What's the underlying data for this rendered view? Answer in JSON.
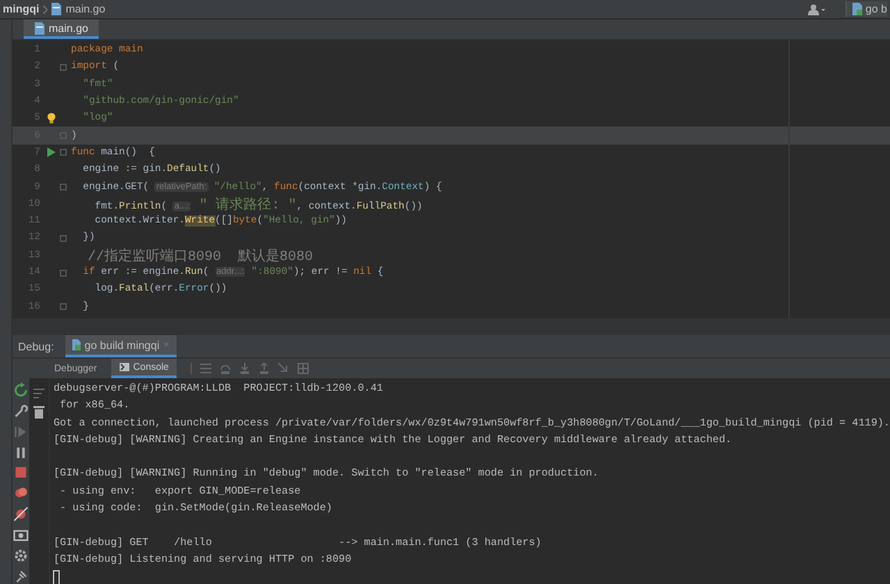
{
  "navbar": {
    "project": "mingqi",
    "file": "main.go",
    "run_config": "go b"
  },
  "editor": {
    "tabs": [
      {
        "label": "main.go",
        "selected": true
      }
    ],
    "lines": [
      {
        "number": "1",
        "current": false,
        "fold": false,
        "run": false,
        "bulb": false,
        "tokens": [
          {
            "text": "package main",
            "kind": "keyword"
          }
        ]
      },
      {
        "number": "2",
        "current": false,
        "fold": true,
        "run": false,
        "bulb": false,
        "tokens": [
          {
            "text": "import",
            "kind": "keyword"
          },
          {
            "text": " (",
            "kind": "plain"
          }
        ]
      },
      {
        "number": "3",
        "current": false,
        "fold": false,
        "run": false,
        "bulb": false,
        "tokens": [
          {
            "text": "  \"fmt\"",
            "kind": "string"
          }
        ]
      },
      {
        "number": "4",
        "current": false,
        "fold": false,
        "run": false,
        "bulb": false,
        "tokens": [
          {
            "text": "  \"github.com/gin-gonic/gin\"",
            "kind": "string"
          }
        ]
      },
      {
        "number": "5",
        "current": false,
        "fold": false,
        "run": false,
        "bulb": true,
        "tokens": [
          {
            "text": "  \"log\"",
            "kind": "string"
          }
        ]
      },
      {
        "number": "6",
        "current": true,
        "fold": true,
        "run": false,
        "bulb": false,
        "tokens": [
          {
            "text": ")",
            "kind": "plain"
          }
        ]
      },
      {
        "number": "7",
        "current": false,
        "fold": true,
        "run": true,
        "bulb": false,
        "tokens": [
          {
            "text": "func",
            "kind": "keyword"
          },
          {
            "text": " main()  {",
            "kind": "plain"
          }
        ]
      },
      {
        "number": "8",
        "current": false,
        "fold": false,
        "run": false,
        "bulb": false,
        "tokens": [
          {
            "text": "  engine := gin.",
            "kind": "plain"
          },
          {
            "text": "Default",
            "kind": "function"
          },
          {
            "text": "()",
            "kind": "plain"
          }
        ]
      },
      {
        "number": "9",
        "current": false,
        "fold": true,
        "run": false,
        "bulb": false,
        "tokens": [
          {
            "text": "  engine.GET( ",
            "kind": "plain"
          },
          {
            "text": "relativePath:",
            "kind": "hint"
          },
          {
            "text": " \"/hello\"",
            "kind": "string"
          },
          {
            "text": ", ",
            "kind": "plain"
          },
          {
            "text": "func",
            "kind": "keyword"
          },
          {
            "text": "(context *gin.",
            "kind": "plain"
          },
          {
            "text": "Context",
            "kind": "type"
          },
          {
            "text": ") {",
            "kind": "plain"
          }
        ]
      },
      {
        "number": "10",
        "current": false,
        "fold": false,
        "run": false,
        "bulb": false,
        "tokens": [
          {
            "text": "    fmt.",
            "kind": "plain"
          },
          {
            "text": "Println",
            "kind": "function"
          },
          {
            "text": "( ",
            "kind": "plain"
          },
          {
            "text": "a...:",
            "kind": "hint"
          },
          {
            "text": " \" 请求路径: \"",
            "kind": "string"
          },
          {
            "text": ", context.",
            "kind": "plain"
          },
          {
            "text": "FullPath",
            "kind": "function"
          },
          {
            "text": "())",
            "kind": "plain"
          }
        ]
      },
      {
        "number": "11",
        "current": false,
        "fold": false,
        "run": false,
        "bulb": false,
        "tokens": [
          {
            "text": "    context.Writer.",
            "kind": "plain"
          },
          {
            "text": "Write",
            "kind": "highlight"
          },
          {
            "text": "([]",
            "kind": "plain"
          },
          {
            "text": "byte",
            "kind": "keyword"
          },
          {
            "text": "(",
            "kind": "plain"
          },
          {
            "text": "\"Hello, gin\"",
            "kind": "string"
          },
          {
            "text": "))",
            "kind": "plain"
          }
        ]
      },
      {
        "number": "12",
        "current": false,
        "fold": true,
        "run": false,
        "bulb": false,
        "tokens": [
          {
            "text": "  })",
            "kind": "plain"
          }
        ]
      },
      {
        "number": "13",
        "current": false,
        "fold": false,
        "run": false,
        "bulb": false,
        "tokens": [
          {
            "text": "  //指定监听端口8090  默认是8080",
            "kind": "comment"
          }
        ]
      },
      {
        "number": "14",
        "current": false,
        "fold": true,
        "run": false,
        "bulb": false,
        "tokens": [
          {
            "text": "  if",
            "kind": "keyword"
          },
          {
            "text": " err := engine.",
            "kind": "plain"
          },
          {
            "text": "Run",
            "kind": "function"
          },
          {
            "text": "( ",
            "kind": "plain"
          },
          {
            "text": "addr...:",
            "kind": "hint"
          },
          {
            "text": " \":8090\"",
            "kind": "string"
          },
          {
            "text": "); err != ",
            "kind": "plain"
          },
          {
            "text": "nil",
            "kind": "keyword"
          },
          {
            "text": " {",
            "kind": "plain"
          }
        ]
      },
      {
        "number": "15",
        "current": false,
        "fold": false,
        "run": false,
        "bulb": false,
        "tokens": [
          {
            "text": "    log.",
            "kind": "plain"
          },
          {
            "text": "Fatal",
            "kind": "function"
          },
          {
            "text": "(err.",
            "kind": "plain"
          },
          {
            "text": "Error",
            "kind": "type"
          },
          {
            "text": "())",
            "kind": "plain"
          }
        ]
      },
      {
        "number": "16",
        "current": false,
        "fold": true,
        "run": false,
        "bulb": false,
        "tokens": [
          {
            "text": "  }",
            "kind": "plain"
          }
        ]
      }
    ]
  },
  "debug": {
    "label": "Debug:",
    "tabs": [
      {
        "label": "go build mingqi",
        "close": "×",
        "selected": true
      }
    ],
    "subtabs": [
      {
        "label": "Debugger",
        "selected": false
      },
      {
        "label": "Console",
        "selected": true
      }
    ],
    "console": {
      "blocks": [
        [
          "debugserver-@(#)PROGRAM:LLDB  PROJECT:lldb-1200.0.41",
          " for x86_64.",
          "Got a connection, launched process /private/var/folders/wx/0z9t4w791wn50wf8rf_b_y3h8080gn/T/GoLand/___1go_build_mingqi (pid = 4119).",
          "[GIN-debug] [WARNING] Creating an Engine instance with the Logger and Recovery middleware already attached."
        ],
        [
          "[GIN-debug] [WARNING] Running in \"debug\" mode. Switch to \"release\" mode in production.",
          " - using env:   export GIN_MODE=release",
          " - using code:  gin.SetMode(gin.ReleaseMode)"
        ],
        [
          "[GIN-debug] GET    /hello                    --> main.main.func1 (3 handlers)",
          "[GIN-debug] Listening and serving HTTP on :8090"
        ]
      ]
    }
  }
}
